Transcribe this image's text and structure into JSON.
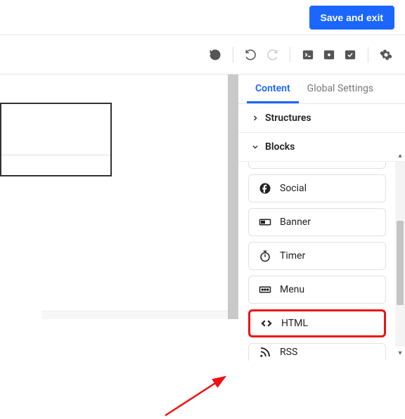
{
  "header": {
    "save_button": "Save and exit"
  },
  "sidebar": {
    "tabs": [
      {
        "label": "Content",
        "active": true
      },
      {
        "label": "Global Settings",
        "active": false
      }
    ],
    "sections": {
      "structures": {
        "label": "Structures",
        "expanded": false
      },
      "blocks": {
        "label": "Blocks",
        "expanded": true
      }
    },
    "blocks": [
      {
        "name": "Social",
        "icon": "social-icon"
      },
      {
        "name": "Banner",
        "icon": "banner-icon"
      },
      {
        "name": "Timer",
        "icon": "timer-icon"
      },
      {
        "name": "Menu",
        "icon": "menu-icon"
      },
      {
        "name": "HTML",
        "icon": "html-icon",
        "highlighted": true
      },
      {
        "name": "RSS",
        "icon": "rss-icon"
      }
    ]
  },
  "toolbar": {
    "history_icon": "history-icon",
    "undo_icon": "undo-icon",
    "redo_icon": "redo-icon",
    "terminal_icon": "terminal-icon",
    "preview_icon": "preview-icon",
    "check_icon": "check-icon",
    "settings_icon": "settings-icon"
  },
  "colors": {
    "primary": "#1b66ff",
    "highlight": "#e11"
  }
}
